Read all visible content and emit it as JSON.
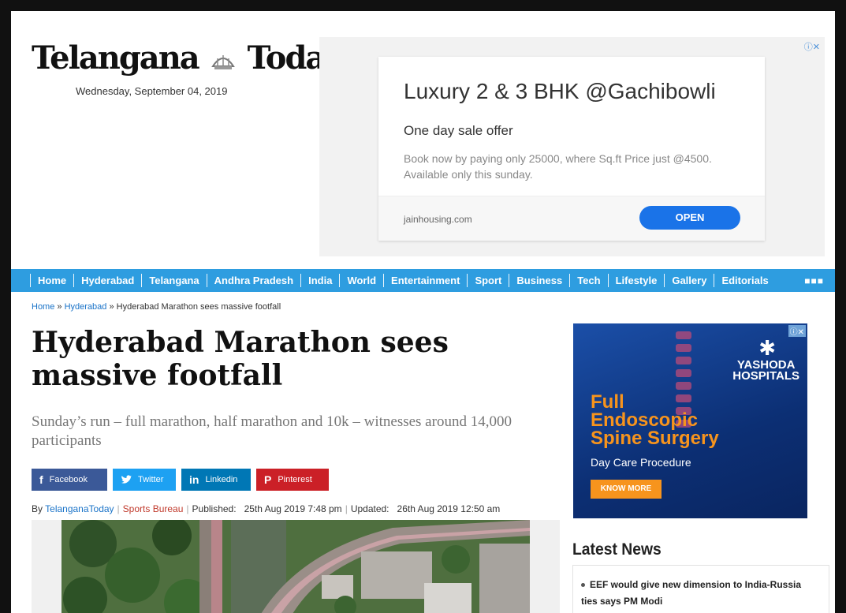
{
  "header": {
    "logo_left": "Telangana",
    "logo_right": "Today",
    "date": "Wednesday, September 04, 2019"
  },
  "top_ad": {
    "title": "Luxury 2 & 3 BHK @Gachibowli",
    "subtitle": "One day sale offer",
    "description": "Book now by paying only 25000, where Sq.ft Price just @4500. Available only this sunday.",
    "domain": "jainhousing.com",
    "cta": "OPEN",
    "adchoice": "ⓘ✕"
  },
  "nav": {
    "items": [
      "Home",
      "Hyderabad",
      "Telangana",
      "Andhra Pradesh",
      "India",
      "World",
      "Entertainment",
      "Sport",
      "Business",
      "Tech",
      "Lifestyle",
      "Gallery",
      "Editorials"
    ],
    "more": "■■■"
  },
  "breadcrumb": {
    "home": "Home",
    "sep": " » ",
    "section": "Hyderabad",
    "current": "Hyderabad Marathon sees massive footfall"
  },
  "article": {
    "headline": "Hyderabad Marathon sees massive footfall",
    "subhead": "Sunday’s run – full marathon, half marathon and 10k – witnesses around 14,000 participants",
    "by_label": "By",
    "author": "TelanganaToday",
    "bureau": "Sports Bureau",
    "published_label": "Published:",
    "published": "25th Aug 2019  7:48 pm",
    "updated_label": "Updated:",
    "updated": "26th Aug 2019  12:50 am"
  },
  "share": {
    "facebook": "Facebook",
    "twitter": "Twitter",
    "linkedin": "Linkedin",
    "pinterest": "Pinterest"
  },
  "side_ad": {
    "corner": "ⓘ✕",
    "brand_line1": "YASHODA",
    "brand_line2": "HOSPITALS",
    "headline_1": "Full",
    "headline_2": "Endoscopic",
    "headline_3": "Spine Surgery",
    "tagline": "Day Care Procedure",
    "cta": "KNOW MORE"
  },
  "latest": {
    "title": "Latest News",
    "items": [
      "EEF would give new dimension to India-Russia ties says PM Modi"
    ]
  }
}
